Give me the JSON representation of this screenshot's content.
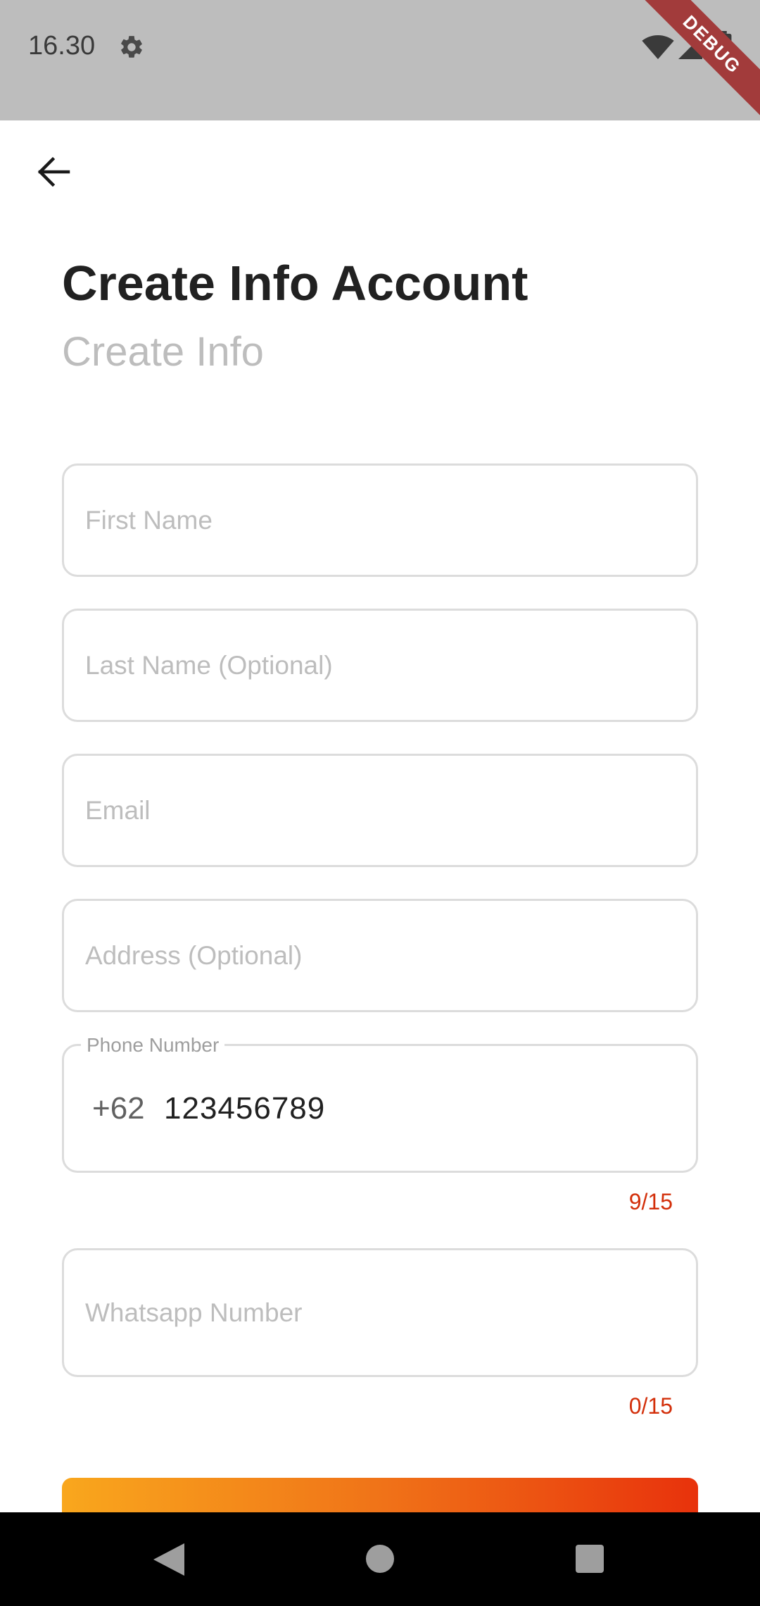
{
  "status_bar": {
    "time": "16.30",
    "debug_label": "DEBUG",
    "icons": [
      "gear-icon",
      "wifi-icon",
      "signal-icon",
      "battery-icon"
    ]
  },
  "header": {
    "back_icon": "arrow-left-icon",
    "title": "Create Info Account",
    "subtitle": "Create Info"
  },
  "form": {
    "first_name": {
      "placeholder": "First Name",
      "value": ""
    },
    "last_name": {
      "placeholder": "Last Name (Optional)",
      "value": ""
    },
    "email": {
      "placeholder": "Email",
      "value": ""
    },
    "address": {
      "placeholder": "Address (Optional)",
      "value": ""
    },
    "phone": {
      "label": "Phone Number",
      "prefix": "+62",
      "value": "123456789",
      "counter": "9/15"
    },
    "whatsapp": {
      "placeholder": "Whatsapp Number",
      "value": "",
      "counter": "0/15"
    }
  },
  "colors": {
    "accent_start": "#f9a71d",
    "accent_end": "#e8320c",
    "counter": "#d32f0a",
    "field_border": "#dcdcdc"
  },
  "nav_bar": {
    "icons": [
      "nav-back-icon",
      "nav-home-icon",
      "nav-recents-icon"
    ]
  }
}
